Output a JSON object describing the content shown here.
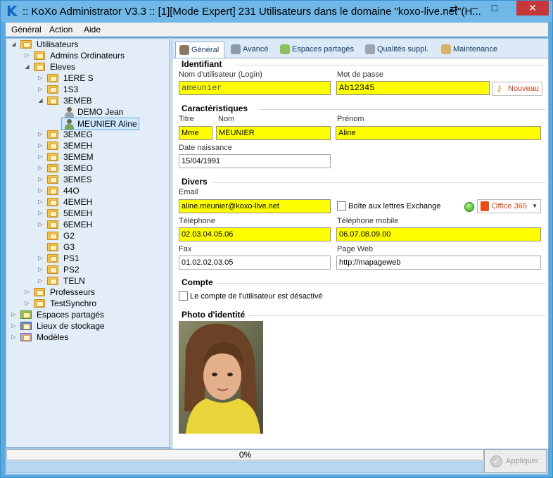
{
  "window": {
    "title": ":: KoXo Administrator V3.3 :: [1][Mode Expert] 231 Utilisateurs dans le domaine \"koxo-live.net\"(H...",
    "logo": "K",
    "minimize": "–",
    "maximize": "□",
    "close": "✕"
  },
  "menu": {
    "items": [
      "Général",
      "Action",
      "Aide"
    ]
  },
  "tree": {
    "root": "Utilisateurs",
    "items": [
      {
        "label": "Admins Ordinateurs"
      },
      {
        "label": "Eleves"
      },
      {
        "label": "1ERE S"
      },
      {
        "label": "1S3"
      },
      {
        "label": "3EMEB"
      },
      {
        "label": "DEMO Jean"
      },
      {
        "label": "MEUNIER Aline"
      },
      {
        "label": "3EMEG"
      },
      {
        "label": "3EMEH"
      },
      {
        "label": "3EMEM"
      },
      {
        "label": "3EMEO"
      },
      {
        "label": "3EMES"
      },
      {
        "label": "44O"
      },
      {
        "label": "4EMEH"
      },
      {
        "label": "5EMEH"
      },
      {
        "label": "6EMEH"
      },
      {
        "label": "G2"
      },
      {
        "label": "G3"
      },
      {
        "label": "PS1"
      },
      {
        "label": "PS2"
      },
      {
        "label": "TELN"
      },
      {
        "label": "Professeurs"
      },
      {
        "label": "TestSynchro"
      },
      {
        "label": "Espaces partagés"
      },
      {
        "label": "Lieux de stockage"
      },
      {
        "label": "Modèles"
      }
    ]
  },
  "tabs": [
    "Général",
    "Avancé",
    "Espaces partagés",
    "Qualités suppl.",
    "Maintenance"
  ],
  "identifiant": {
    "title": "Identifiant",
    "login_label": "Nom d'utilisateur (Login)",
    "login_value": "ameunier",
    "password_label": "Mot de passe",
    "password_value": "Ab12345",
    "new_button": "Nouveau"
  },
  "caracteristiques": {
    "title": "Caractéristiques",
    "titre_label": "Titre",
    "titre_value": "Mme",
    "nom_label": "Nom",
    "nom_value": "MEUNIER",
    "prenom_label": "Prénom",
    "prenom_value": "Aline",
    "naissance_label": "Date naissance",
    "naissance_value": "15/04/1991"
  },
  "divers": {
    "title": "Divers",
    "email_label": "Email",
    "email_value": "aline.meunier@koxo-live.net",
    "exchange_label": "Boîte aux lettres Exchange",
    "office_button": "Office 365",
    "telephone_label": "Téléphone",
    "telephone_value": "02.03.04.05.06",
    "mobile_label": "Téléphone mobile",
    "mobile_value": "06.07.08.09.00",
    "fax_label": "Fax",
    "fax_value": "01.02.02.03.05",
    "web_label": "Page Web",
    "web_value": "http://mapageweb"
  },
  "compte": {
    "title": "Compte",
    "disabled_label": "Le compte de l'utilisateur est désactivé"
  },
  "photo": {
    "title": "Photo d'identité"
  },
  "status": {
    "progress": "0%",
    "apply_button": "Appliquer",
    "apply_icon": "✓"
  },
  "colors": {
    "field_highlight": "#ffff00",
    "accent": "#5aaae2",
    "close_button": "#c7373a"
  }
}
